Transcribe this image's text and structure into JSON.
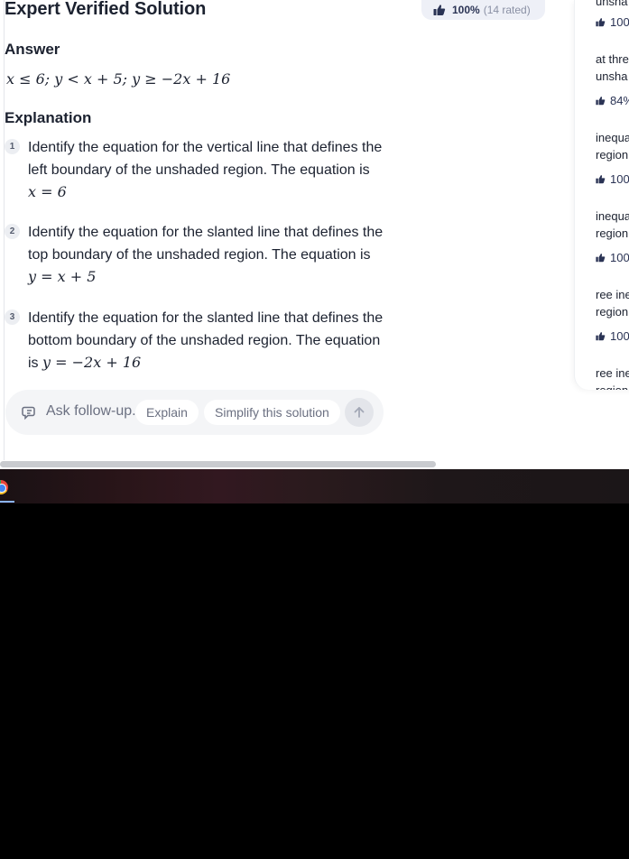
{
  "header": {
    "title": "Expert Verified Solution",
    "rating_pct": "100%",
    "rating_count": "(14 rated)"
  },
  "answer": {
    "heading": "Answer",
    "math": "x ≤ 6; y < x + 5; y ≥ −2x + 16"
  },
  "explanation": {
    "heading": "Explanation",
    "steps": [
      {
        "number": "1",
        "text": "Identify the equation for the vertical line that defines the left boundary of the unshaded region. The equation is",
        "math": "x = 6"
      },
      {
        "number": "2",
        "text": "Identify the equation for the slanted line that defines the top boundary of the unshaded region. The equation is",
        "math": "y = x + 5"
      },
      {
        "number": "3",
        "text": "Identify the equation for the slanted line that defines the bottom boundary of the unshaded region. The equation is",
        "math": "y = −2x + 16"
      }
    ]
  },
  "followup": {
    "placeholder": "Ask follow-up.",
    "chips": [
      "Explain",
      "Simplify this solution"
    ]
  },
  "side_panel": {
    "items": [
      {
        "text": "unsha"
      },
      {
        "rating": "100"
      },
      {
        "text": "at thre"
      },
      {
        "text": "unsha"
      },
      {
        "rating": "84%"
      },
      {
        "text": "inequa"
      },
      {
        "text": "region"
      },
      {
        "rating": "100"
      },
      {
        "text": "inequa"
      },
      {
        "text": "region"
      },
      {
        "rating": "100"
      },
      {
        "text": "ree ine"
      },
      {
        "text": "region"
      },
      {
        "rating": "100"
      },
      {
        "text": "ree ine"
      },
      {
        "text": "region"
      }
    ]
  },
  "colors": {
    "accent": "#2a3354",
    "text": "#1c2230",
    "muted": "#6b7081",
    "pill_bg": "#eef0f7"
  },
  "icons": {
    "thumb": "thumbs-up-icon",
    "followup": "ask-followup-icon",
    "send": "arrow-up-icon",
    "taskbar_app": "chrome-icon"
  }
}
